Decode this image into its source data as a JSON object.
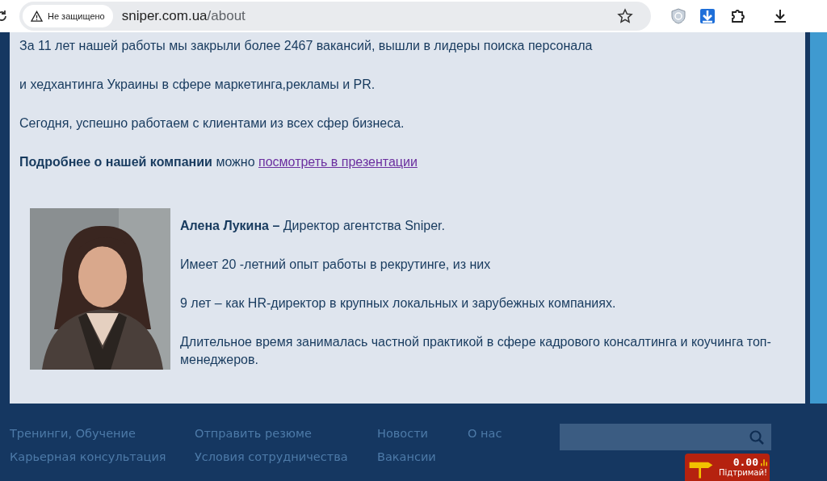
{
  "browser": {
    "security_label": "Не защищено",
    "url_host": "sniper.com.ua",
    "url_path": "/about"
  },
  "intro": [
    {
      "text": "За 11 лет нашей работы мы закрыли  более 2467 вакансий, вышли в лидеры поиска персонала"
    },
    {
      "text": "и хедхантинга Украины  в сфере маркетинга,рекламы и PR."
    },
    {
      "text": "Сегодня, успешно  работаем с клиентами из всех сфер бизнеса."
    },
    {
      "text": "**Подробнее о нашей компании** можно",
      "link": "посмотреть в презентации"
    }
  ],
  "profile": {
    "paragraphs": [
      "**Алена Лукина –** Директор агентства Sniper.",
      "Имеет 20 -летний опыт работы в рекрутинге, из них",
      "9 лет – как HR-директор в крупных локальных и зарубежных компаниях.",
      "Длительное время занималась частной практикой в сфере кадрового консалтинга и коучинга топ-менеджеров."
    ]
  },
  "footer": {
    "columns": [
      [
        "Тренинги, Обучение",
        "Карьерная консультация"
      ],
      [
        "Отправить резюме",
        "Условия сотрудничества"
      ],
      [
        "Новости",
        "Вакансии"
      ],
      [
        "О нас"
      ]
    ],
    "counter": {
      "value": "0.00",
      "caption": "Підтримай!"
    }
  }
}
